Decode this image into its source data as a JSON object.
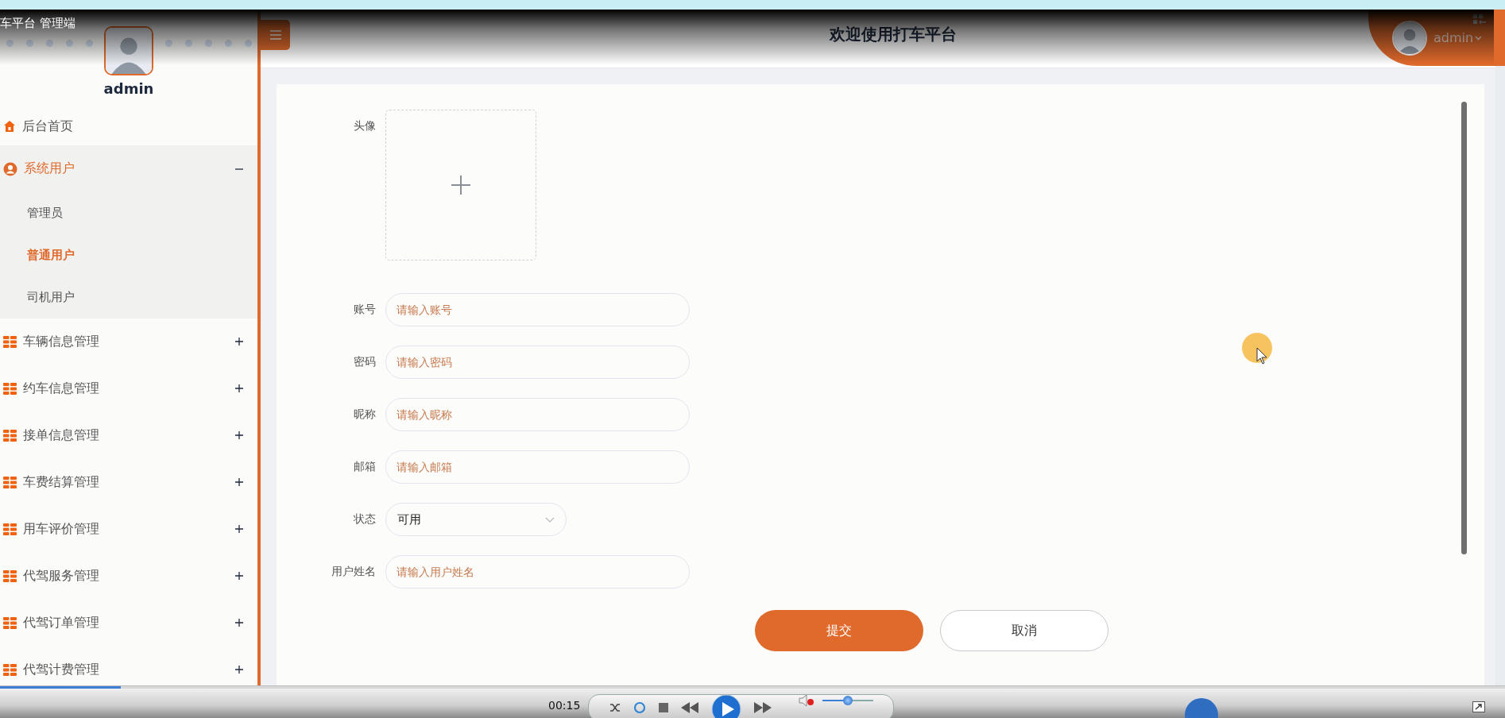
{
  "player": {
    "title": "车平台 管理端",
    "time": "00:15",
    "seek": {
      "level": 0.08
    },
    "volume": {
      "level": 0.5
    }
  },
  "sidebar": {
    "user": "admin",
    "items": [
      {
        "label": "后台首页",
        "kind": "link"
      },
      {
        "label": "系统用户",
        "kind": "group",
        "expanded": true,
        "children": [
          {
            "label": "管理员",
            "selected": false
          },
          {
            "label": "普通用户",
            "selected": true
          },
          {
            "label": "司机用户",
            "selected": false
          }
        ]
      },
      {
        "label": "车辆信息管理",
        "kind": "group",
        "expanded": false
      },
      {
        "label": "约车信息管理",
        "kind": "group",
        "expanded": false
      },
      {
        "label": "接单信息管理",
        "kind": "group",
        "expanded": false
      },
      {
        "label": "车费结算管理",
        "kind": "group",
        "expanded": false
      },
      {
        "label": "用车评价管理",
        "kind": "group",
        "expanded": false
      },
      {
        "label": "代驾服务管理",
        "kind": "group",
        "expanded": false
      },
      {
        "label": "代驾订单管理",
        "kind": "group",
        "expanded": false
      },
      {
        "label": "代驾计费管理",
        "kind": "group",
        "expanded": false
      }
    ]
  },
  "header": {
    "title": "欢迎使用打车平台",
    "user": "admin"
  },
  "form": {
    "fields": [
      {
        "label": "头像",
        "kind": "upload"
      },
      {
        "label": "账号",
        "kind": "text",
        "placeholder": "请输入账号"
      },
      {
        "label": "密码",
        "kind": "text",
        "placeholder": "请输入密码"
      },
      {
        "label": "昵称",
        "kind": "text",
        "placeholder": "请输入昵称"
      },
      {
        "label": "邮箱",
        "kind": "text",
        "placeholder": "请输入邮箱"
      },
      {
        "label": "状态",
        "kind": "select",
        "value": "可用"
      },
      {
        "label": "用户姓名",
        "kind": "text",
        "placeholder": "请输入用户姓名"
      }
    ],
    "buttons": [
      {
        "label": "提交",
        "kind": "primary"
      },
      {
        "label": "取消",
        "kind": "plain"
      }
    ]
  }
}
